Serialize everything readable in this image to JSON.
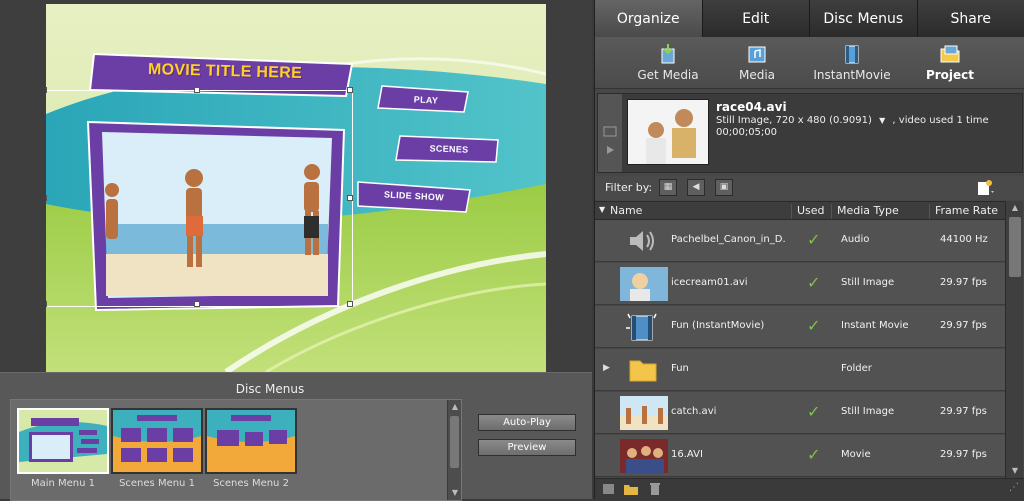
{
  "canvas": {
    "movie_title": "MOVIE TITLE HERE",
    "buttons": [
      "PLAY",
      "SCENES",
      "SLIDE SHOW"
    ]
  },
  "disc_menus": {
    "title": "Disc Menus",
    "thumbnails": [
      "Main Menu 1",
      "Scenes Menu 1",
      "Scenes Menu 2"
    ],
    "autoplay_label": "Auto-Play",
    "preview_label": "Preview"
  },
  "tabs": [
    {
      "label": "Organize",
      "active": true
    },
    {
      "label": "Edit",
      "active": false
    },
    {
      "label": "Disc Menus",
      "active": false
    },
    {
      "label": "Share",
      "active": false
    }
  ],
  "subtabs": [
    {
      "label": "Get Media",
      "icon": "get-media-icon"
    },
    {
      "label": "Media",
      "icon": "media-icon"
    },
    {
      "label": "InstantMovie",
      "icon": "instant-movie-icon"
    },
    {
      "label": "Project",
      "icon": "project-folder-icon",
      "active": true
    }
  ],
  "preview": {
    "filename": "race04.avi",
    "details": "Still Image, 720 x 480 (0.9091)",
    "used": ", video used 1 time",
    "timecode": "00;00;05;00"
  },
  "filter": {
    "label": "Filter by:"
  },
  "table": {
    "headers": [
      "Name",
      "Used",
      "Media Type",
      "Frame Rate"
    ],
    "rows": [
      {
        "name": "Pachelbel_Canon_in_D.",
        "used": "✓",
        "type": "Audio",
        "rate": "44100 Hz",
        "icon": "audio-speaker-icon"
      },
      {
        "name": "icecream01.avi",
        "used": "✓",
        "type": "Still Image",
        "rate": "29.97 fps",
        "icon": "still-image-thumbnail"
      },
      {
        "name": "Fun (InstantMovie)",
        "used": "✓",
        "type": "Instant Movie",
        "rate": "29.97 fps",
        "icon": "instant-movie-icon"
      },
      {
        "name": "Fun",
        "used": "",
        "type": "Folder",
        "rate": "",
        "icon": "folder-icon"
      },
      {
        "name": "catch.avi",
        "used": "✓",
        "type": "Still Image",
        "rate": "29.97 fps",
        "icon": "still-image-thumbnail"
      },
      {
        "name": "16.AVI",
        "used": "✓",
        "type": "Movie",
        "rate": "29.97 fps",
        "icon": "movie-thumbnail"
      }
    ]
  },
  "colors": {
    "accent_purple": "#6a3aa0",
    "check_green": "#7ec34a",
    "title_yellow": "#ffd02a"
  }
}
